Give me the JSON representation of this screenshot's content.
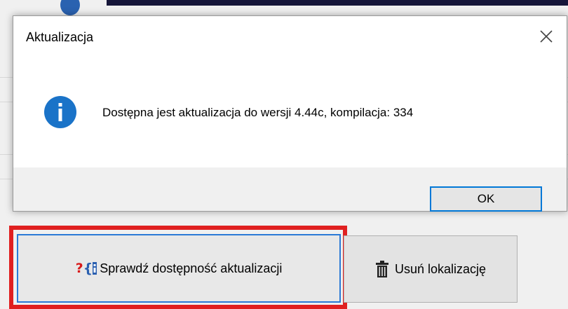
{
  "dialog": {
    "title": "Aktualizacja",
    "close_icon": "close-icon",
    "message": "Dostępna jest aktualizacja do wersji 4.44c, kompilacja: 334",
    "message_icon": "info-icon",
    "ok_label": "OK"
  },
  "actions": {
    "check_updates_label": "Sprawdź dostępność aktualizacji",
    "check_updates_icon": "question-brace-icon",
    "remove_localization_label": "Usuń lokalizację",
    "remove_localization_icon": "trash-icon"
  },
  "colors": {
    "highlight": "#e02020",
    "accent": "#0078d7",
    "info": "#1a73c8"
  }
}
